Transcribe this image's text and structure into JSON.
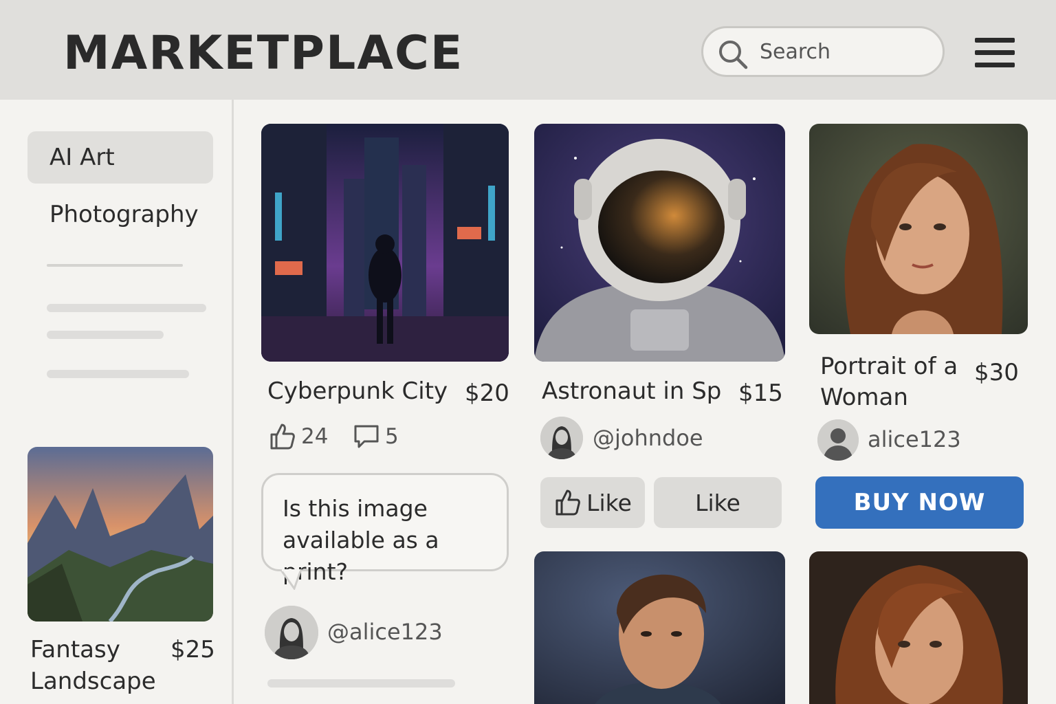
{
  "header": {
    "logo": "MARKETPLACE",
    "search_placeholder": "Search"
  },
  "sidebar": {
    "items": [
      {
        "label": "AI Art",
        "active": true
      },
      {
        "label": "Photography",
        "active": false
      }
    ],
    "featured": {
      "title_line1": "Fantasy",
      "title_line2": "Landscape",
      "price": "$25"
    }
  },
  "listings": [
    {
      "title": "Cyberpunk City",
      "price": "$20",
      "likes": "24",
      "comments": "5"
    },
    {
      "title": "Astronaut in Sp",
      "price": "$15",
      "user": "@johndoe",
      "like_button": "Like",
      "like_button_2": "Like"
    },
    {
      "title_line1": "Portrait of a",
      "title_line2": "Woman",
      "price": "$30",
      "user": "alice123",
      "buy_button": "BUY NOW"
    }
  ],
  "comment": {
    "line1": "Is this image",
    "line2": "available as a print?",
    "user": "@alice123"
  },
  "colors": {
    "header_bg": "#e0dfdc",
    "page_bg": "#f4f3f0",
    "buy_button": "#3470bd"
  }
}
